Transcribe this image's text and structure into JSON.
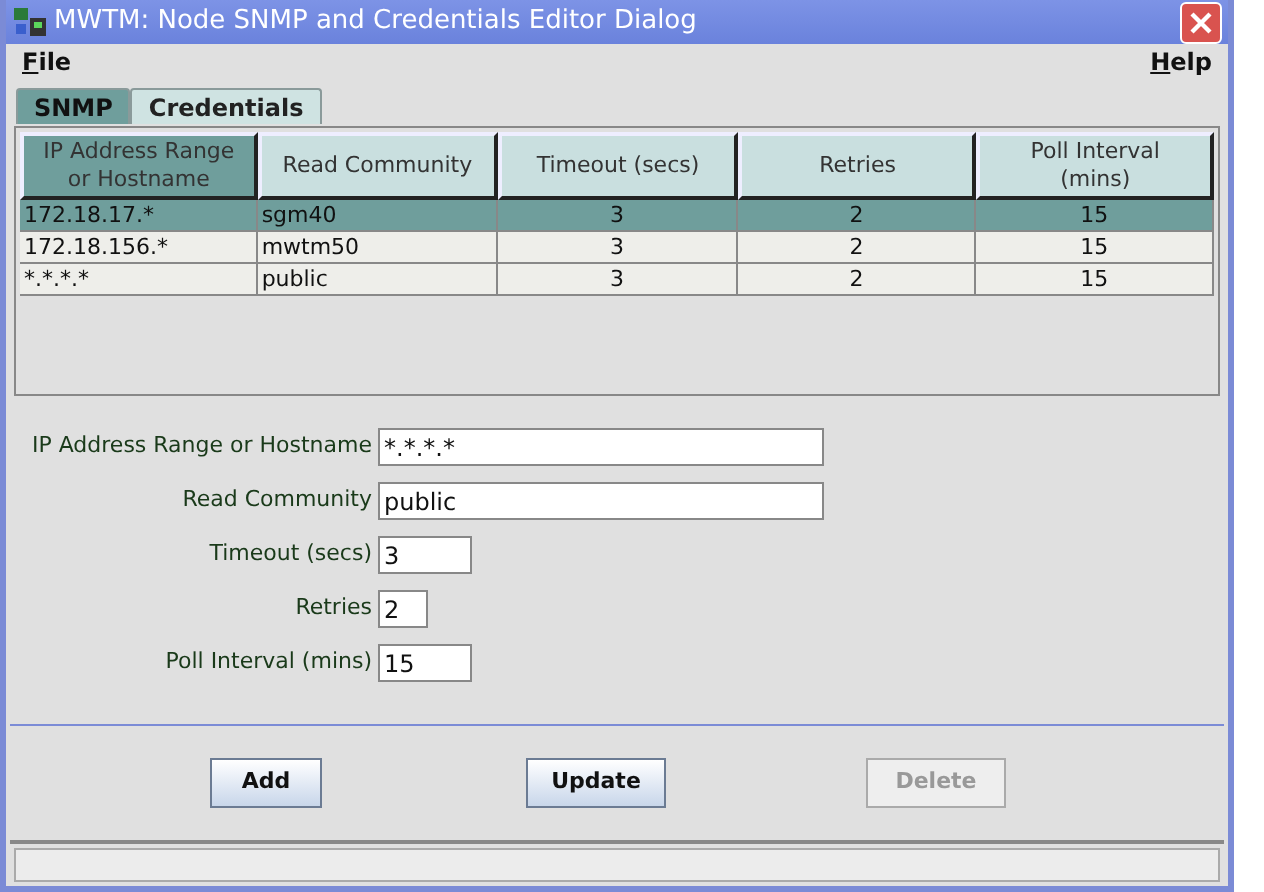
{
  "window": {
    "title": "MWTM: Node SNMP and Credentials Editor Dialog"
  },
  "menu": [
    {
      "label": "File"
    },
    {
      "label": "Help"
    }
  ],
  "tabs": [
    {
      "label": "SNMP",
      "selected": true
    },
    {
      "label": "Credentials",
      "selected": false
    }
  ],
  "table": {
    "columns": [
      {
        "label": "IP Address Range or Hostname",
        "selected": true
      },
      {
        "label": "Read Community",
        "selected": false
      },
      {
        "label": "Timeout (secs)",
        "selected": false
      },
      {
        "label": "Retries",
        "selected": false
      },
      {
        "label": "Poll Interval (mins)",
        "selected": false
      }
    ],
    "rows": [
      {
        "selected": true,
        "cells": [
          "172.18.17.*",
          "sgm40",
          "3",
          "2",
          "15"
        ]
      },
      {
        "selected": false,
        "cells": [
          "172.18.156.*",
          "mwtm50",
          "3",
          "2",
          "15"
        ]
      },
      {
        "selected": false,
        "cells": [
          "*.*.*.*",
          "public",
          "3",
          "2",
          "15"
        ]
      }
    ]
  },
  "form": [
    {
      "label": "IP Address Range or Hostname",
      "value": "*.*.*.*"
    },
    {
      "label": "Read Community",
      "value": "public"
    },
    {
      "label": "Timeout (secs)",
      "value": "3"
    },
    {
      "label": "Retries",
      "value": "2"
    },
    {
      "label": "Poll Interval (mins)",
      "value": "15"
    }
  ],
  "buttons": [
    {
      "label": "Add",
      "disabled": false
    },
    {
      "label": "Update",
      "disabled": false
    },
    {
      "label": "Delete",
      "disabled": true
    }
  ]
}
